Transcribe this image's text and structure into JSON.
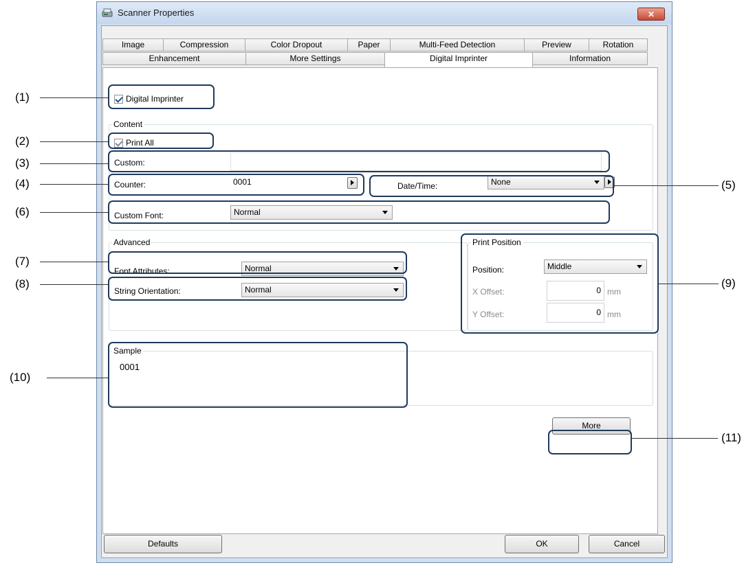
{
  "window": {
    "title": "Scanner Properties",
    "close_label": "✕"
  },
  "tabs_row1": [
    "Image",
    "Compression",
    "Color Dropout",
    "Paper",
    "Multi-Feed Detection",
    "Preview",
    "Rotation"
  ],
  "tabs_row2": [
    "Enhancement",
    "More Settings",
    "Digital Imprinter",
    "Information"
  ],
  "active_tab": "Digital Imprinter",
  "digital_imprinter": {
    "label": "Digital Imprinter",
    "checked": true
  },
  "content": {
    "legend": "Content",
    "print_all": {
      "label": "Print All",
      "checked": true
    },
    "custom": {
      "label": "Custom:",
      "value": ""
    },
    "counter": {
      "label": "Counter:",
      "value": "0001"
    },
    "datetime": {
      "label": "Date/Time:",
      "value": "None"
    },
    "custom_font": {
      "label": "Custom Font:",
      "value": "Normal"
    }
  },
  "advanced": {
    "legend": "Advanced",
    "font_attributes": {
      "label": "Font Attributes:",
      "value": "Normal"
    },
    "string_orientation": {
      "label": "String Orientation:",
      "value": "Normal"
    }
  },
  "print_position": {
    "legend": "Print Position",
    "position": {
      "label": "Position:",
      "value": "Middle"
    },
    "x_offset": {
      "label": "X Offset:",
      "value": "0",
      "unit": "mm"
    },
    "y_offset": {
      "label": "Y Offset:",
      "value": "0",
      "unit": "mm"
    }
  },
  "sample": {
    "legend": "Sample",
    "text": "0001"
  },
  "buttons": {
    "more": "More",
    "defaults": "Defaults",
    "ok": "OK",
    "cancel": "Cancel"
  },
  "callouts": [
    "(1)",
    "(2)",
    "(3)",
    "(4)",
    "(5)",
    "(6)",
    "(7)",
    "(8)",
    "(9)",
    "(10)",
    "(11)"
  ],
  "colors": {
    "callout_border": "#1f3a5c",
    "window_frame": "#cfdff0",
    "close_button": "#c64a35"
  },
  "icons": {
    "app": "scanner-icon",
    "close": "close-icon"
  }
}
